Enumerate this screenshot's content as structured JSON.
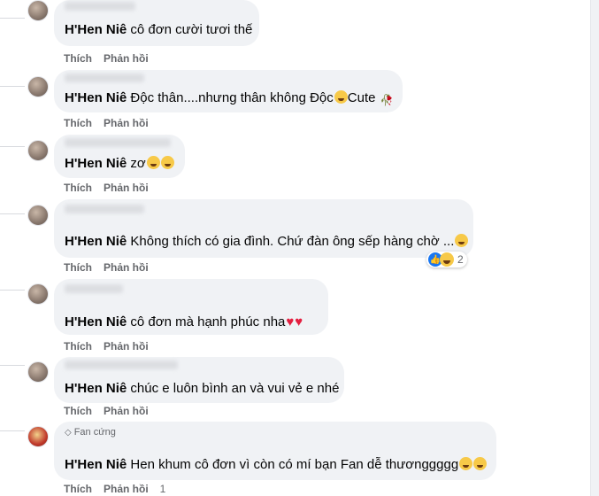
{
  "actions": {
    "like": "Thích",
    "reply": "Phản hồi"
  },
  "comments": [
    {
      "mention": "H'Hen Niê",
      "text": " cô đơn cười tươi thế",
      "emoji": []
    },
    {
      "mention": "H'Hen Niê",
      "text": " Độc thân....nhưng thân không Độc",
      "emoji": [
        "smile"
      ],
      "suffix": "Cute",
      "emoji2": [
        "rose"
      ]
    },
    {
      "mention": "H'Hen Niê",
      "text": " zơ",
      "emoji": [
        "laugh",
        "laugh"
      ]
    },
    {
      "mention": "H'Hen Niê",
      "text": " Không thích có gia đình. Chứ đàn ông sếp hàng chờ ...",
      "emoji": [
        "smile"
      ],
      "reaction_count": "2"
    },
    {
      "mention": "H'Hen Niê",
      "text": " cô đơn mà hạnh phúc nha",
      "emoji": [
        "heart",
        "heart"
      ]
    },
    {
      "mention": "H'Hen Niê",
      "text": " chúc e luôn bình an và vui vẻ e nhé",
      "emoji": []
    },
    {
      "badge": "Fan cứng",
      "mention": "H'Hen Niê",
      "text": " Hen khum cô đơn vì còn có mí bạn Fan dễ thươnggggg",
      "emoji": [
        "laugh",
        "laugh"
      ],
      "extra": "1"
    }
  ],
  "colors": {
    "bubble": "#f0f2f5",
    "muted": "#65676b",
    "like_blue": "#1877f2",
    "heart": "#e41e3f"
  }
}
